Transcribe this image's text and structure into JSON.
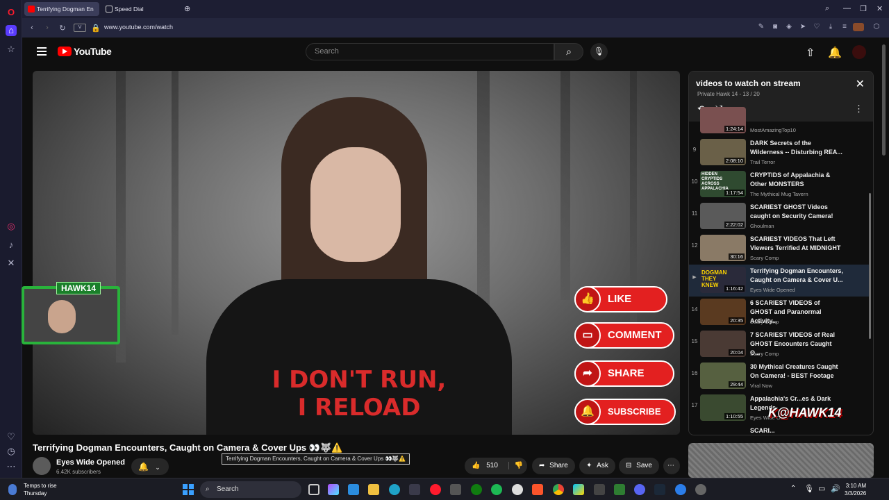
{
  "browser": {
    "tabs": [
      {
        "label": "Terrifying Dogman En"
      },
      {
        "label": "Speed Dial"
      }
    ],
    "url": "www.youtube.com/watch",
    "view_badge": "V"
  },
  "youtube": {
    "logo_text": "YouTube",
    "search_placeholder": "Search"
  },
  "video": {
    "shirt_text_line1": "I DON'T RUN,",
    "shirt_text_line2": "I RELOAD",
    "overlay_buttons": [
      "LIKE",
      "COMMENT",
      "SHARE",
      "SUBSCRIBE"
    ],
    "webcam_tag": "HAWK14",
    "title": "Terrifying Dogman Encounters, Caught on Camera & Cover Ups 👀🐺⚠️",
    "tooltip": "Terrifying Dogman Encounters, Caught on Camera & Cover Ups 👀🐺⚠️",
    "channel": "Eyes Wide Opened",
    "subscribers": "6.42K subscribers",
    "likes": "510",
    "share_label": "Share",
    "ask_label": "Ask",
    "save_label": "Save"
  },
  "playlist": {
    "title": "videos to watch on stream",
    "subtitle": "Private  Hawk 14 - 13 / 20",
    "items": [
      {
        "index": "",
        "duration": "1:24:14",
        "title": "",
        "channel": "MostAmazingTop10"
      },
      {
        "index": "9",
        "duration": "2:08:10",
        "title": "DARK Secrets of the Wilderness -- Disturbing REA...",
        "channel": "Trail Terror"
      },
      {
        "index": "10",
        "duration": "1:17:54",
        "title": "CRYPTIDS of Appalachia & Other MONSTERS",
        "channel": "The Mythical Mug Tavern"
      },
      {
        "index": "11",
        "duration": "2:22:02",
        "title": "SCARIEST GHOST Videos caught on Security Camera!",
        "channel": "Ghoulman"
      },
      {
        "index": "12",
        "duration": "30:16",
        "title": "SCARIEST VIDEOS That Left Viewers Terrified At MIDNIGHT",
        "channel": "Scary Comp"
      },
      {
        "index": "▶",
        "duration": "1:16:42",
        "title": "Terrifying Dogman Encounters, Caught on Camera & Cover U...",
        "channel": "Eyes Wide Opened"
      },
      {
        "index": "14",
        "duration": "20:35",
        "title": "6 SCARIEST VIDEOS of GHOST and Paranormal Activity...",
        "channel": "Scary Comp"
      },
      {
        "index": "15",
        "duration": "20:04",
        "title": "7 SCARIEST VIDEOS of Real GHOST Encounters Caught O...",
        "channel": "Scary Comp"
      },
      {
        "index": "16",
        "duration": "29:44",
        "title": "30 Mythical Creatures Caught On Camera! - BEST Footage",
        "channel": "Viral Now"
      },
      {
        "index": "17",
        "duration": "1:10:55",
        "title": "Appalachia's Cr...es & Dark Legends",
        "channel": "Eyes Wide O..."
      },
      {
        "index": "",
        "duration": "",
        "title": "SCARI...",
        "channel": ""
      }
    ],
    "thumb_text_10": "HIDDEN CRYPTIDS ACROSS APPALACHIA",
    "thumb_text_current": "DOGMAN THEY KNEW"
  },
  "watermark": "K@HAWK14",
  "taskbar": {
    "weather_line1": "Temps to rise",
    "weather_line2": "Thursday",
    "search_label": "Search",
    "time": "3:10 AM",
    "date": "3/3/2026"
  }
}
